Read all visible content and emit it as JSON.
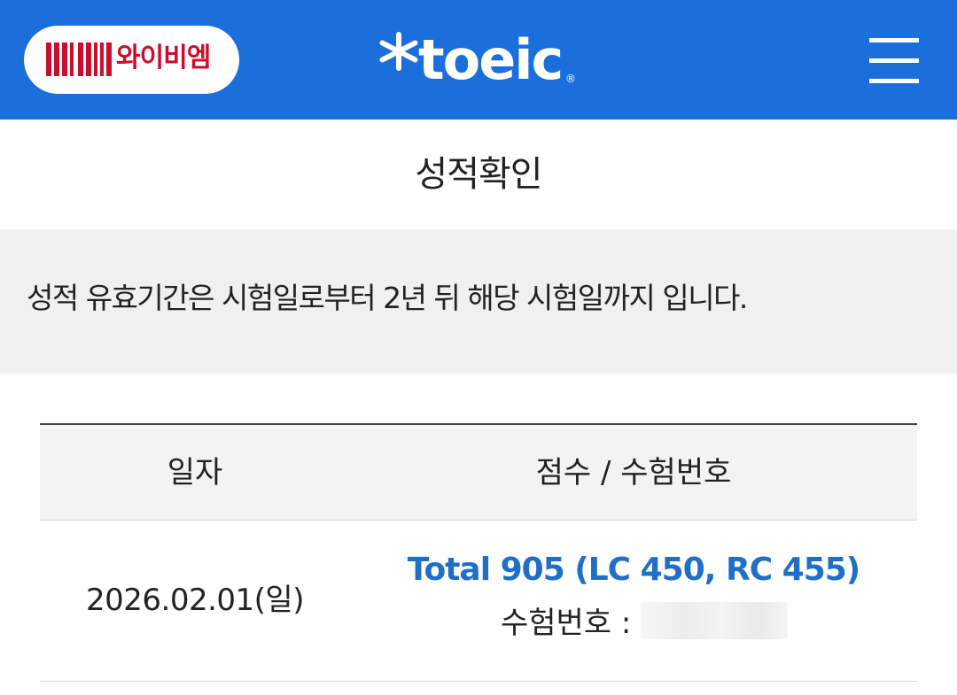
{
  "header": {
    "brand_name": "와이비엠",
    "brand_logo_text": "YBM",
    "logo_text": "toeic",
    "logo_reg_mark": "®",
    "background_color": "#1a6fdc",
    "menu_icon": "hamburger-menu-icon"
  },
  "page": {
    "title": "성적확인"
  },
  "notice": {
    "text": "성적 유효기간은 시험일로부터 2년 뒤 해당 시험일까지 입니다."
  },
  "table": {
    "columns": [
      "일자",
      "점수 / 수험번호"
    ],
    "rows": [
      {
        "date": "2026.02.01(일)",
        "score_summary": "Total 905 (LC 450, RC 455)",
        "exam_number_label": "수험번호 :"
      }
    ]
  },
  "colors": {
    "accent_blue": "#1a6fdc",
    "score_link": "#1f6fc8",
    "brand_red": "#c8102e",
    "notice_bg": "#f0f0f0"
  }
}
